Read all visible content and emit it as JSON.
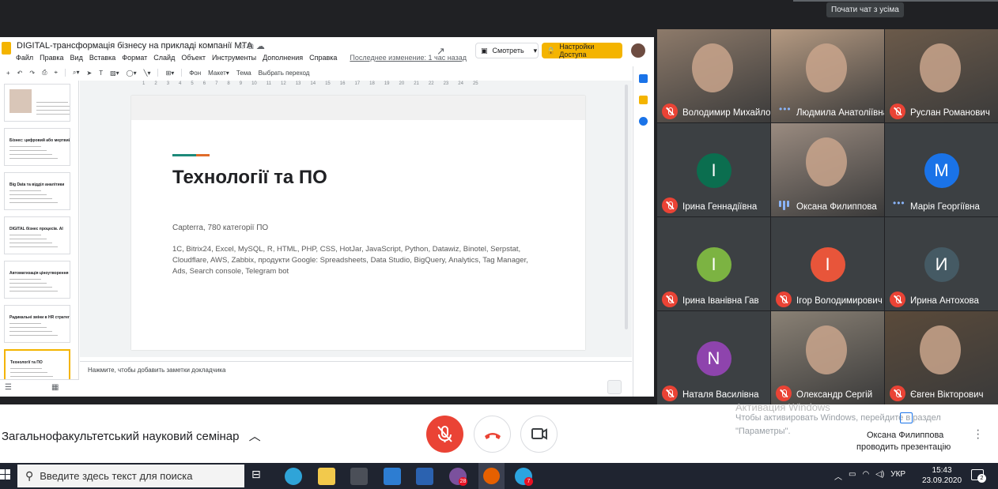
{
  "top": {
    "tooltip": "Почати чат з усіма"
  },
  "slides_app": {
    "doc_title": "DIGITAL-трансформація бізнесу на прикладі компанії МТА",
    "menu": [
      "Файл",
      "Правка",
      "Вид",
      "Вставка",
      "Формат",
      "Слайд",
      "Объект",
      "Инструменты",
      "Дополнения",
      "Справка"
    ],
    "last_edit": "Последнее изменение: 1 час назад",
    "view_button": "Смотреть",
    "share_button": "Настройки Доступа",
    "toolbar": {
      "background": "Фон",
      "layout": "Макет",
      "theme": "Тема",
      "transition": "Выбрать переход"
    },
    "ruler": [
      "1",
      "2",
      "3",
      "4",
      "5",
      "6",
      "7",
      "8",
      "9",
      "10",
      "11",
      "12",
      "13",
      "14",
      "15",
      "16",
      "17",
      "18",
      "19",
      "20",
      "21",
      "22",
      "23",
      "24",
      "25"
    ],
    "thumbnails": [
      {
        "title": "",
        "active": false
      },
      {
        "title": "Бізнес: цифровий або мертвий",
        "active": false
      },
      {
        "title": "Big Data та відділ аналітики",
        "active": false
      },
      {
        "title": "DIGITAL бізнес процесів. AI",
        "active": false
      },
      {
        "title": "Автоматизація ціноутворення",
        "active": false
      },
      {
        "title": "Радикальні зміни в НR стратегії",
        "active": false
      },
      {
        "title": "Технології та ПО",
        "active": true
      }
    ],
    "slide": {
      "heading": "Технології та ПО",
      "subheading": "Capterra, 780 категорії ПО",
      "body": "1С, Bitrix24, Excel, MySQL, R, HTML, PHP, CSS, HotJar, JavaScript, Python, Datawiz, Binotel, Serpstat, Cloudflare, AWS, Zabbix, продукти Google: Spreadsheets, Data Studio, BigQuery, Analytics, Tag Manager, Ads, Search console, Telegram bot",
      "accent_colors": [
        "#1e8a7a",
        "#e06c2a"
      ]
    },
    "notes_placeholder": "Нажмите, чтобы добавить заметки докладчика"
  },
  "participants": [
    {
      "name": "Володимир Михайлович",
      "type": "video",
      "muted": true,
      "bg": "#8d7a6a"
    },
    {
      "name": "Людмила Анатоліївна",
      "type": "video",
      "muted": false,
      "bg": "#b59a82"
    },
    {
      "name": "Руслан Романович",
      "type": "video",
      "muted": true,
      "bg": "#6b5a4a"
    },
    {
      "name": "Ірина Геннадіївна",
      "type": "avatar",
      "initial": "I",
      "color": "#0b6e4f",
      "muted": true
    },
    {
      "name": "Оксана Филиппова",
      "type": "video",
      "muted": false,
      "speaking": true,
      "bg": "#9a8b80"
    },
    {
      "name": "Марія Георгіївна",
      "type": "avatar",
      "initial": "M",
      "color": "#1a73e8",
      "muted": false
    },
    {
      "name": "Ірина Іванівна Гав",
      "type": "avatar",
      "initial": "I",
      "color": "#7cb342",
      "muted": true
    },
    {
      "name": "Ігор Володимирович",
      "type": "avatar",
      "initial": "I",
      "color": "#e8553a",
      "muted": true
    },
    {
      "name": "Ирина Антохова",
      "type": "avatar",
      "initial": "И",
      "color": "#455a64",
      "muted": true
    },
    {
      "name": "Наталя Василівна",
      "type": "avatar",
      "initial": "N",
      "color": "#8e44ad",
      "muted": true
    },
    {
      "name": "Олександр Сергій",
      "type": "video",
      "muted": true,
      "bg": "#8a8175"
    },
    {
      "name": "Євген Вікторович",
      "type": "video",
      "muted": true,
      "bg": "#5a4a3a"
    }
  ],
  "meeting": {
    "title": "Загальнофакультетський науковий семінар",
    "presenter_line1": "Оксана Филиппова",
    "presenter_line2": "проводить презентацію",
    "watermark_line1": "Активация Windows",
    "watermark_line2": "Чтобы активировать Windows, перейдите в раздел",
    "watermark_line3": "\"Параметры\"."
  },
  "taskbar": {
    "search_placeholder": "Введите здесь текст для поиска",
    "language": "УКР",
    "time": "15:43",
    "date": "23.09.2020",
    "badge_viber": "28",
    "badge_telegram": "7",
    "badge_notifications": "2"
  }
}
